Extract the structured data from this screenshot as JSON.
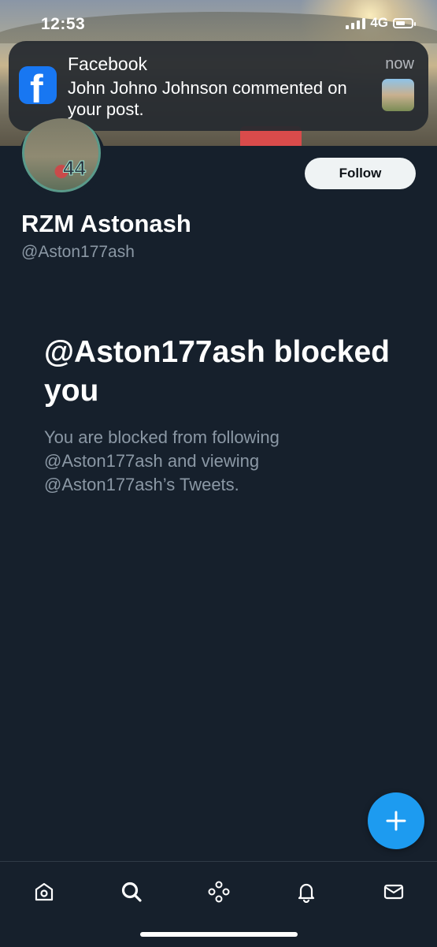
{
  "status_bar": {
    "time": "12:53",
    "network": "4G"
  },
  "notification": {
    "app_name": "Facebook",
    "message": "John Johno Johnson commented on your post.",
    "time": "now",
    "logo_glyph": "f",
    "brand_color": "#1877f2"
  },
  "profile": {
    "display_name": "RZM Astonash",
    "handle": "@Aston177ash",
    "avatar_number": "44",
    "follow_label": "Follow"
  },
  "blocked": {
    "title": "@Aston177ash blocked you",
    "description": "You are blocked from following @Aston177ash and viewing @Aston177ash’s Tweets."
  },
  "fab": {
    "icon": "plus-icon",
    "color": "#1d9bf0"
  },
  "bottom_nav": {
    "items": [
      {
        "name": "home",
        "icon": "home-icon"
      },
      {
        "name": "search",
        "icon": "search-icon",
        "active": true
      },
      {
        "name": "spaces",
        "icon": "spaces-icon"
      },
      {
        "name": "notifications",
        "icon": "bell-icon"
      },
      {
        "name": "messages",
        "icon": "mail-icon"
      }
    ]
  },
  "colors": {
    "background": "#16202c",
    "muted_text": "#8b98a5",
    "accent": "#1d9bf0"
  }
}
